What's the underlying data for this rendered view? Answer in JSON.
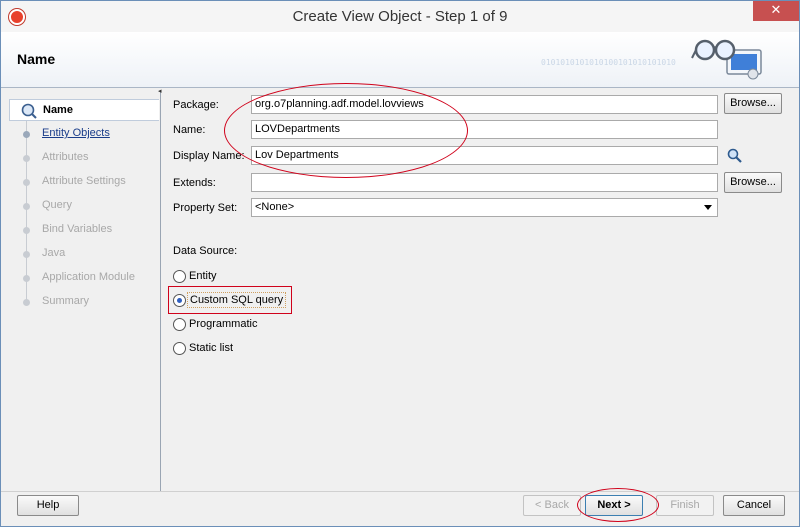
{
  "window": {
    "title": "Create View Object - Step 1 of 9",
    "close_label": "✕"
  },
  "header": {
    "title": "Name",
    "binary": "0101010101010100101010101010"
  },
  "nav": {
    "items": [
      {
        "label": "Name",
        "state": "active"
      },
      {
        "label": "Entity Objects",
        "state": "link"
      },
      {
        "label": "Attributes",
        "state": "disabled"
      },
      {
        "label": "Attribute Settings",
        "state": "disabled"
      },
      {
        "label": "Query",
        "state": "disabled"
      },
      {
        "label": "Bind Variables",
        "state": "disabled"
      },
      {
        "label": "Java",
        "state": "disabled"
      },
      {
        "label": "Application Module",
        "state": "disabled"
      },
      {
        "label": "Summary",
        "state": "disabled"
      }
    ]
  },
  "form": {
    "package": {
      "label": "Package:",
      "value": "org.o7planning.adf.model.lovviews",
      "browse": "Browse..."
    },
    "name": {
      "label": "Name:",
      "value": "LOVDepartments"
    },
    "display_name": {
      "label": "Display Name:",
      "value": "Lov Departments"
    },
    "extends": {
      "label": "Extends:",
      "value": "",
      "browse": "Browse..."
    },
    "property_set": {
      "label": "Property Set:",
      "value": "<None>"
    },
    "data_source": {
      "label": "Data Source:",
      "options": [
        {
          "label": "Entity",
          "checked": false
        },
        {
          "label": "Custom SQL query",
          "checked": true
        },
        {
          "label": "Programmatic",
          "checked": false
        },
        {
          "label": "Static list",
          "checked": false
        }
      ]
    }
  },
  "footer": {
    "help": "Help",
    "back": "< Back",
    "next": "Next >",
    "finish": "Finish",
    "cancel": "Cancel"
  },
  "colors": {
    "annotation": "#d0021b",
    "link": "#1a3d8a",
    "close": "#c75050"
  }
}
